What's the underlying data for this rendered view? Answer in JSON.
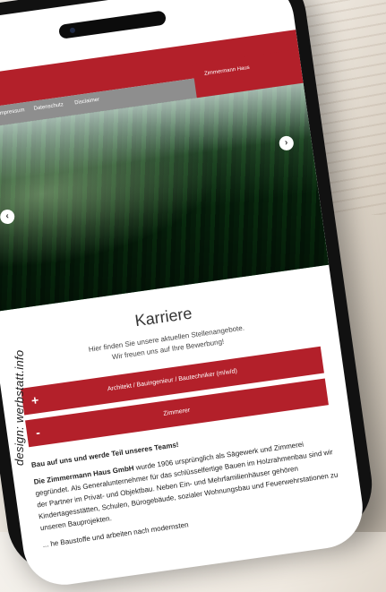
{
  "credit": "design: werbstatt.info",
  "site": {
    "brand": "Zimmermann Haus",
    "subnav": [
      "Impressum",
      "Datenschutz",
      "Disclaimer"
    ]
  },
  "page": {
    "title": "Karriere",
    "intro_line1": "Hier finden Sie unsere aktuellen Stellenangebote.",
    "intro_line2": "Wir freuen uns auf Ihre Bewerbung!"
  },
  "accordion": [
    {
      "sign": "+",
      "label": "Architekt / Bauingenieur / Bautechniker (m/w/d)"
    },
    {
      "sign": "-",
      "label": "Zimmerer"
    }
  ],
  "body": {
    "heading": "Bau auf uns und werde Teil unseres Teams!",
    "p1_company": "Die Zimmermann Haus GmbH",
    "p1_rest": " wurde 1906 ursprünglich als Sägewerk und Zimmerei gegründet. Als Generalunternehmer für das schlüsselfertige Bauen im Holzrahmenbau sind wir der Partner im Privat- und Objektbau. Neben Ein- und Mehrfamilienhäuser gehören Kindertagesstätten, Schulen, Bürogebäude, sozialer Wohnungsbau und Feuerwehrstationen zu unseren Bauprojekten.",
    "p2_tail": "... he Baustoffe und arbeiten nach modernsten"
  },
  "colors": {
    "accent": "#b3202a",
    "subnav": "#8e8e8e"
  }
}
